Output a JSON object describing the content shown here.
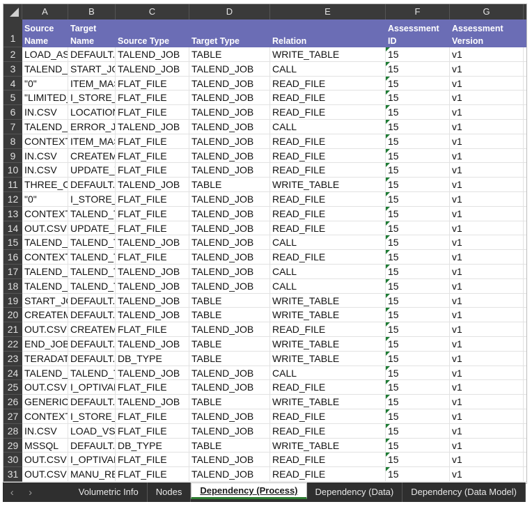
{
  "columns": [
    "A",
    "B",
    "C",
    "D",
    "E",
    "F",
    "G"
  ],
  "header_row": {
    "row_number": "1",
    "labels": [
      "Source\nName",
      "Target\nName",
      "Source Type",
      "Target Type",
      "Relation",
      "Assessment ID",
      "Assessment\nVersion"
    ]
  },
  "rows": [
    {
      "n": "2",
      "a": "LOAD_ASD",
      "b": "DEFAULT.",
      "c": "TALEND_JOB",
      "d": "TABLE",
      "e": "WRITE_TABLE",
      "f": "15",
      "g": "v1"
    },
    {
      "n": "3",
      "a": "TALEND_T",
      "b": "START_JOB",
      "c": "TALEND_JOB",
      "d": "TALEND_JOB",
      "e": "CALL",
      "f": "15",
      "g": "v1"
    },
    {
      "n": "4",
      "a": "\"0\"",
      "b": "ITEM_MAS",
      "c": "FLAT_FILE",
      "d": "TALEND_JOB",
      "e": "READ_FILE",
      "f": "15",
      "g": "v1"
    },
    {
      "n": "5",
      "a": "\"LIMITED_",
      "b": "I_STORE_F",
      "c": "FLAT_FILE",
      "d": "TALEND_JOB",
      "e": "READ_FILE",
      "f": "15",
      "g": "v1"
    },
    {
      "n": "6",
      "a": "IN.CSV",
      "b": "LOCATION",
      "c": "FLAT_FILE",
      "d": "TALEND_JOB",
      "e": "READ_FILE",
      "f": "15",
      "g": "v1"
    },
    {
      "n": "7",
      "a": "TALEND_T",
      "b": "ERROR_JO",
      "c": "TALEND_JOB",
      "d": "TALEND_JOB",
      "e": "CALL",
      "f": "15",
      "g": "v1"
    },
    {
      "n": "8",
      "a": "CONTEXT.",
      "b": "ITEM_MAS",
      "c": "FLAT_FILE",
      "d": "TALEND_JOB",
      "e": "READ_FILE",
      "f": "15",
      "g": "v1"
    },
    {
      "n": "9",
      "a": "IN.CSV",
      "b": "CREATEMU",
      "c": "FLAT_FILE",
      "d": "TALEND_JOB",
      "e": "READ_FILE",
      "f": "15",
      "g": "v1"
    },
    {
      "n": "10",
      "a": "IN.CSV",
      "b": "UPDATE_T",
      "c": "FLAT_FILE",
      "d": "TALEND_JOB",
      "e": "READ_FILE",
      "f": "15",
      "g": "v1"
    },
    {
      "n": "11",
      "a": "THREE_CC",
      "b": "DEFAULT.",
      "c": "TALEND_JOB",
      "d": "TABLE",
      "e": "WRITE_TABLE",
      "f": "15",
      "g": "v1"
    },
    {
      "n": "12",
      "a": "\"0\"",
      "b": "I_STORE_F",
      "c": "FLAT_FILE",
      "d": "TALEND_JOB",
      "e": "READ_FILE",
      "f": "15",
      "g": "v1"
    },
    {
      "n": "13",
      "a": "CONTEXT.",
      "b": "TALEND_T",
      "c": "FLAT_FILE",
      "d": "TALEND_JOB",
      "e": "READ_FILE",
      "f": "15",
      "g": "v1"
    },
    {
      "n": "14",
      "a": "OUT.CSV",
      "b": "UPDATE_T",
      "c": "FLAT_FILE",
      "d": "TALEND_JOB",
      "e": "READ_FILE",
      "f": "15",
      "g": "v1"
    },
    {
      "n": "15",
      "a": "TALEND_T",
      "b": "TALEND_T",
      "c": "TALEND_JOB",
      "d": "TALEND_JOB",
      "e": "CALL",
      "f": "15",
      "g": "v1"
    },
    {
      "n": "16",
      "a": "CONTEXT.",
      "b": "TALEND_T",
      "c": "FLAT_FILE",
      "d": "TALEND_JOB",
      "e": "READ_FILE",
      "f": "15",
      "g": "v1"
    },
    {
      "n": "17",
      "a": "TALEND_T",
      "b": "TALEND_T",
      "c": "TALEND_JOB",
      "d": "TALEND_JOB",
      "e": "CALL",
      "f": "15",
      "g": "v1"
    },
    {
      "n": "18",
      "a": "TALEND_T",
      "b": "TALEND_T",
      "c": "TALEND_JOB",
      "d": "TALEND_JOB",
      "e": "CALL",
      "f": "15",
      "g": "v1"
    },
    {
      "n": "19",
      "a": "START_JOE",
      "b": "DEFAULT.",
      "c": "TALEND_JOB",
      "d": "TABLE",
      "e": "WRITE_TABLE",
      "f": "15",
      "g": "v1"
    },
    {
      "n": "20",
      "a": "CREATEMU",
      "b": "DEFAULT.",
      "c": "TALEND_JOB",
      "d": "TABLE",
      "e": "WRITE_TABLE",
      "f": "15",
      "g": "v1"
    },
    {
      "n": "21",
      "a": "OUT.CSV",
      "b": "CREATEMU",
      "c": "FLAT_FILE",
      "d": "TALEND_JOB",
      "e": "READ_FILE",
      "f": "15",
      "g": "v1"
    },
    {
      "n": "22",
      "a": "END_JOB_",
      "b": "DEFAULT.",
      "c": "TALEND_JOB",
      "d": "TABLE",
      "e": "WRITE_TABLE",
      "f": "15",
      "g": "v1"
    },
    {
      "n": "23",
      "a": "TERADATA",
      "b": "DEFAULT.",
      "c": "DB_TYPE",
      "d": "TABLE",
      "e": "WRITE_TABLE",
      "f": "15",
      "g": "v1"
    },
    {
      "n": "24",
      "a": "TALEND_T",
      "b": "TALEND_T",
      "c": "TALEND_JOB",
      "d": "TALEND_JOB",
      "e": "CALL",
      "f": "15",
      "g": "v1"
    },
    {
      "n": "25",
      "a": "OUT.CSV",
      "b": "I_OPTIVAR",
      "c": "FLAT_FILE",
      "d": "TALEND_JOB",
      "e": "READ_FILE",
      "f": "15",
      "g": "v1"
    },
    {
      "n": "26",
      "a": "GENERIC_",
      "b": "DEFAULT.",
      "c": "TALEND_JOB",
      "d": "TABLE",
      "e": "WRITE_TABLE",
      "f": "15",
      "g": "v1"
    },
    {
      "n": "27",
      "a": "CONTEXT.",
      "b": "I_STORE_F",
      "c": "FLAT_FILE",
      "d": "TALEND_JOB",
      "e": "READ_FILE",
      "f": "15",
      "g": "v1"
    },
    {
      "n": "28",
      "a": "IN.CSV",
      "b": "LOAD_VSD",
      "c": "FLAT_FILE",
      "d": "TALEND_JOB",
      "e": "READ_FILE",
      "f": "15",
      "g": "v1"
    },
    {
      "n": "29",
      "a": "MSSQL",
      "b": "DEFAULT.",
      "c": "DB_TYPE",
      "d": "TABLE",
      "e": "WRITE_TABLE",
      "f": "15",
      "g": "v1"
    },
    {
      "n": "30",
      "a": "OUT.CSV",
      "b": "I_OPTIVAL",
      "c": "FLAT_FILE",
      "d": "TALEND_JOB",
      "e": "READ_FILE",
      "f": "15",
      "g": "v1"
    },
    {
      "n": "31",
      "a": "OUT.CSV",
      "b": "MANU_RE",
      "c": "FLAT_FILE",
      "d": "TALEND_JOB",
      "e": "READ_FILE",
      "f": "15",
      "g": "v1"
    }
  ],
  "tabs": {
    "prev_icon": "chevron-left-icon",
    "next_icon": "chevron-right-icon",
    "items": [
      "Volumetric Info",
      "Nodes",
      "Dependency (Process)",
      "Dependency (Data)",
      "Dependency (Data Model)"
    ],
    "active": "Dependency (Process)"
  },
  "colors": {
    "header_fill": "#6b6db5",
    "chrome": "#3a3a3a",
    "active_tab_underline": "#2e7d32",
    "number_as_text_flag": "#1e7b34"
  }
}
